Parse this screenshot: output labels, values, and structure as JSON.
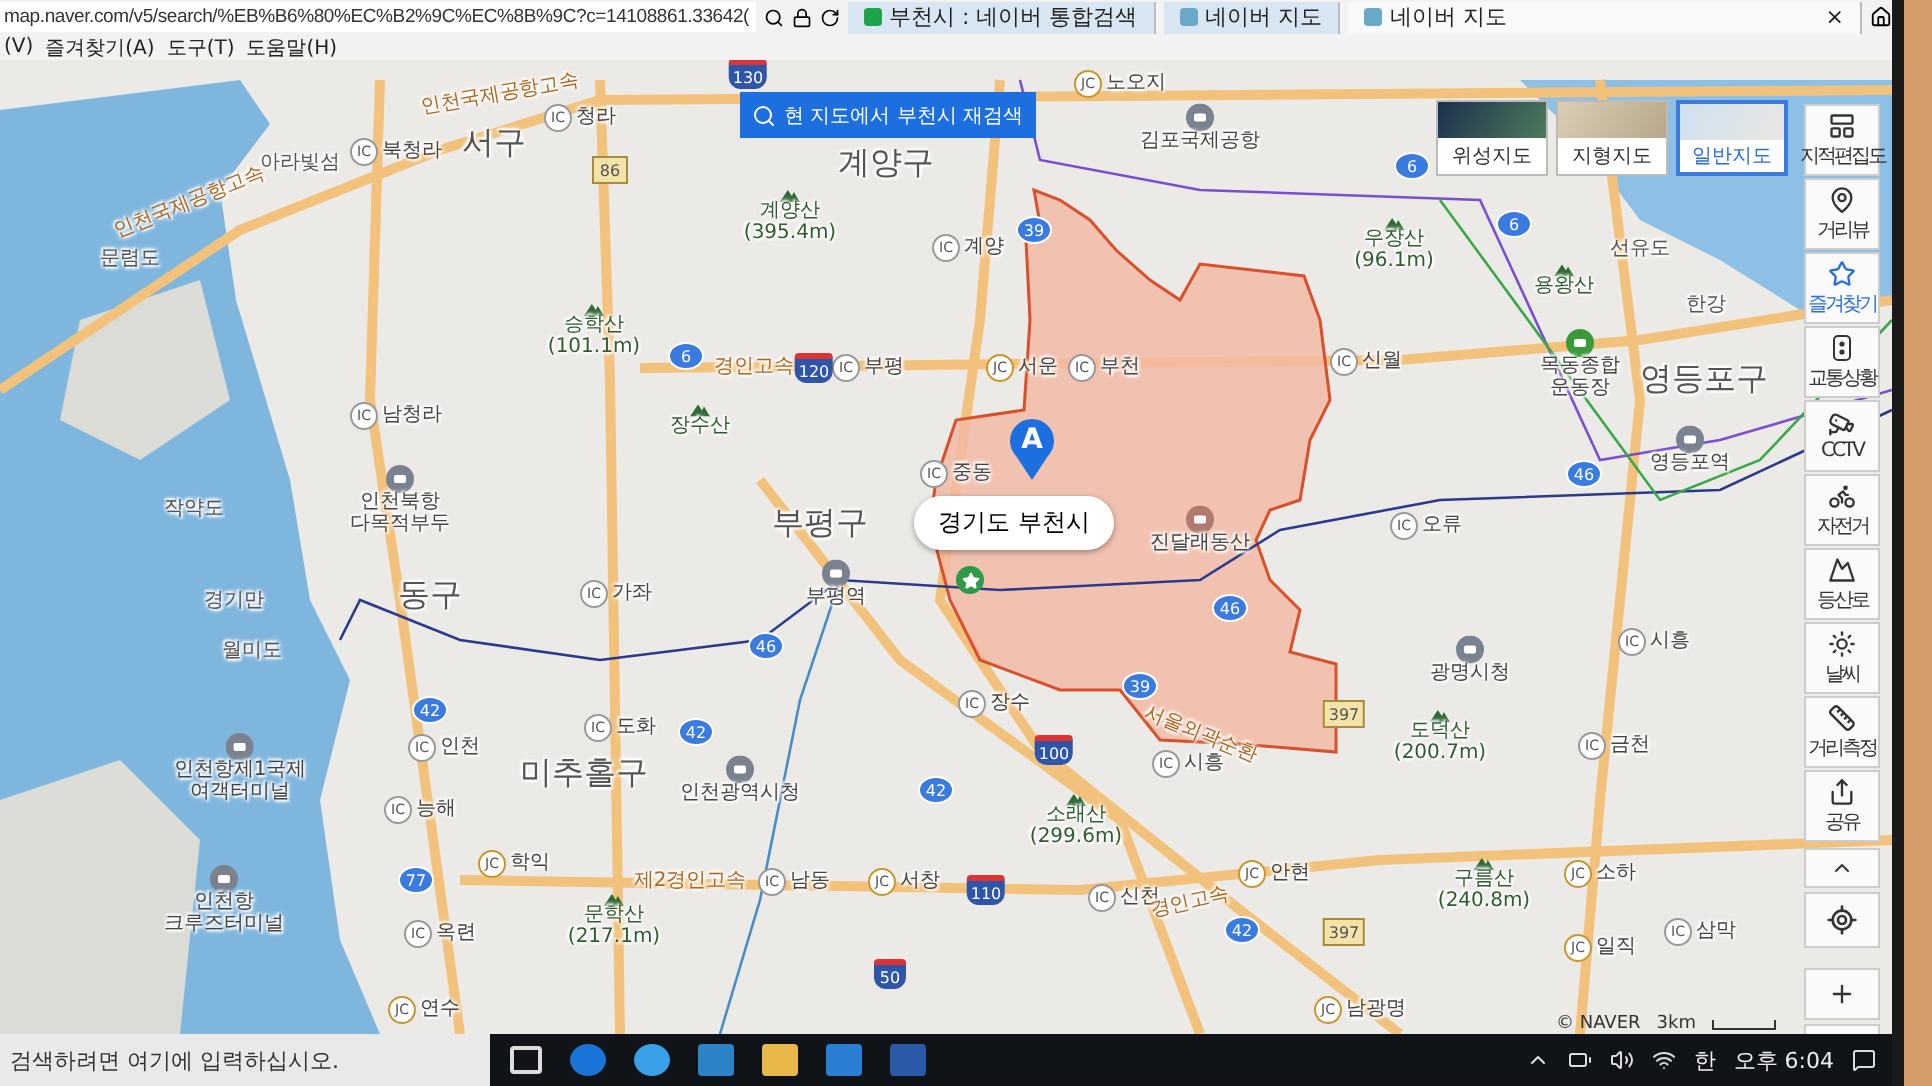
{
  "browser": {
    "address": "map.naver.com/v5/search/%EB%B6%80%EC%B2%9C%EC%8B%9C?c=14108861.33642(",
    "tabs": [
      {
        "label": "부천시 : 네이버 통합검색",
        "selected": false
      },
      {
        "label": "네이버 지도",
        "selected": false
      },
      {
        "label": "네이버 지도",
        "selected": true,
        "close": "×"
      }
    ],
    "menu": [
      "(V)",
      "즐겨찾기(A)",
      "도구(T)",
      "도움말(H)"
    ]
  },
  "map": {
    "research_button": "현 지도에서 부천시 재검색",
    "map_types": [
      {
        "label": "위성지도",
        "selected": false
      },
      {
        "label": "지형지도",
        "selected": false
      },
      {
        "label": "일반지도",
        "selected": true
      }
    ],
    "tools": [
      {
        "label": "지적편집도",
        "selected": false
      },
      {
        "label": "거리뷰",
        "selected": false
      },
      {
        "label": "즐겨찾기",
        "selected": true
      },
      {
        "label": "교통상황",
        "selected": false
      },
      {
        "label": "CCTV",
        "selected": false
      },
      {
        "label": "자전거",
        "selected": false
      },
      {
        "label": "등산로",
        "selected": false
      },
      {
        "label": "날씨",
        "selected": false
      },
      {
        "label": "거리측정",
        "selected": false
      },
      {
        "label": "공유",
        "selected": false
      }
    ],
    "marker": {
      "letter": "A",
      "label": "경기도 부천시"
    },
    "labels": [
      {
        "kind": "district",
        "text": "서구"
      },
      {
        "kind": "district",
        "text": "계양구"
      },
      {
        "kind": "district",
        "text": "부평구"
      },
      {
        "kind": "district",
        "text": "동구"
      },
      {
        "kind": "district",
        "text": "미추홀구"
      },
      {
        "kind": "district",
        "text": "영등포구"
      },
      {
        "kind": "place",
        "text": "아라빛섬"
      },
      {
        "kind": "place",
        "text": "문렴도"
      },
      {
        "kind": "place",
        "text": "작약도"
      },
      {
        "kind": "place",
        "text": "경기만"
      },
      {
        "kind": "place",
        "text": "월미도"
      },
      {
        "kind": "terminal",
        "text": "인천북항",
        "sub": "다목적부두"
      },
      {
        "kind": "terminal",
        "text": "인천항제1국제",
        "sub": "여객터미널"
      },
      {
        "kind": "terminal",
        "text": "인천항",
        "sub": "크루즈터미널"
      },
      {
        "kind": "airport",
        "text": "김포국제공항"
      },
      {
        "kind": "station",
        "text": "부평역"
      },
      {
        "kind": "station",
        "text": "영등포역"
      },
      {
        "kind": "hall",
        "text": "인천광역시청"
      },
      {
        "kind": "hall",
        "text": "광명시청"
      },
      {
        "kind": "stadium",
        "text": "목동종합",
        "sub": "운동장"
      },
      {
        "kind": "place",
        "text": "선유도"
      },
      {
        "kind": "place",
        "text": "한강"
      },
      {
        "kind": "park",
        "text": "진달래동산"
      },
      {
        "kind": "mountain",
        "text": "계양산",
        "sub": "(395.4m)"
      },
      {
        "kind": "mountain",
        "text": "승학산",
        "sub": "(101.1m)"
      },
      {
        "kind": "mountain",
        "text": "장수산"
      },
      {
        "kind": "mountain",
        "text": "우장산",
        "sub": "(96.1m)"
      },
      {
        "kind": "mountain",
        "text": "용왕산"
      },
      {
        "kind": "mountain",
        "text": "소래산",
        "sub": "(299.6m)"
      },
      {
        "kind": "mountain",
        "text": "문학산",
        "sub": "(217.1m)"
      },
      {
        "kind": "mountain",
        "text": "도덕산",
        "sub": "(200.7m)"
      },
      {
        "kind": "mountain",
        "text": "구름산",
        "sub": "(240.8m)"
      },
      {
        "kind": "interchange",
        "badge": "IC",
        "text": "청라"
      },
      {
        "kind": "interchange",
        "badge": "IC",
        "text": "북청라"
      },
      {
        "kind": "interchange",
        "badge": "IC",
        "text": "남청라"
      },
      {
        "kind": "interchange",
        "badge": "IC",
        "text": "부평"
      },
      {
        "kind": "interchange",
        "badge": "IC",
        "text": "계양"
      },
      {
        "kind": "interchange",
        "badge": "JC",
        "text": "서운"
      },
      {
        "kind": "interchange",
        "badge": "IC",
        "text": "부천"
      },
      {
        "kind": "interchange",
        "badge": "IC",
        "text": "신월"
      },
      {
        "kind": "interchange",
        "badge": "IC",
        "text": "중동"
      },
      {
        "kind": "interchange",
        "badge": "IC",
        "text": "가좌"
      },
      {
        "kind": "interchange",
        "badge": "IC",
        "text": "오류"
      },
      {
        "kind": "interchange",
        "badge": "IC",
        "text": "도화"
      },
      {
        "kind": "interchange",
        "badge": "IC",
        "text": "인천"
      },
      {
        "kind": "interchange",
        "badge": "IC",
        "text": "장수"
      },
      {
        "kind": "interchange",
        "badge": "IC",
        "text": "시흥"
      },
      {
        "kind": "interchange",
        "badge": "IC",
        "text": "능해"
      },
      {
        "kind": "interchange",
        "badge": "JC",
        "text": "학익"
      },
      {
        "kind": "interchange",
        "badge": "IC",
        "text": "남동"
      },
      {
        "kind": "interchange",
        "badge": "JC",
        "text": "서창"
      },
      {
        "kind": "interchange",
        "badge": "IC",
        "text": "신천"
      },
      {
        "kind": "interchange",
        "badge": "JC",
        "text": "안현"
      },
      {
        "kind": "interchange",
        "badge": "IC",
        "text": "시흥"
      },
      {
        "kind": "interchange",
        "badge": "IC",
        "text": "금천"
      },
      {
        "kind": "interchange",
        "badge": "JC",
        "text": "소하"
      },
      {
        "kind": "interchange",
        "badge": "IC",
        "text": "옥련"
      },
      {
        "kind": "interchange",
        "badge": "JC",
        "text": "일직"
      },
      {
        "kind": "interchange",
        "badge": "IC",
        "text": "삼막"
      },
      {
        "kind": "interchange",
        "badge": "JC",
        "text": "연수"
      },
      {
        "kind": "interchange",
        "badge": "JC",
        "text": "남광명"
      },
      {
        "kind": "interchange",
        "badge": "JC",
        "text": "노오지"
      },
      {
        "kind": "road",
        "text": "인천국제공항고속"
      },
      {
        "kind": "road",
        "text": "인천국제공항고속"
      },
      {
        "kind": "road",
        "text": "경인고속"
      },
      {
        "kind": "road",
        "text": "제2경인고속"
      },
      {
        "kind": "road",
        "text": "서울외곽순환"
      },
      {
        "kind": "road",
        "text": "경인고속"
      },
      {
        "kind": "expressway",
        "text": "130"
      },
      {
        "kind": "national",
        "text": "86"
      },
      {
        "kind": "route",
        "text": "6"
      },
      {
        "kind": "expressway",
        "text": "120"
      },
      {
        "kind": "route",
        "text": "39"
      },
      {
        "kind": "route",
        "text": "6"
      },
      {
        "kind": "route",
        "text": "6"
      },
      {
        "kind": "route",
        "text": "46"
      },
      {
        "kind": "route",
        "text": "42"
      },
      {
        "kind": "route",
        "text": "42"
      },
      {
        "kind": "route",
        "text": "42"
      },
      {
        "kind": "route",
        "text": "77"
      },
      {
        "kind": "expressway",
        "text": "100"
      },
      {
        "kind": "route",
        "text": "39"
      },
      {
        "kind": "route",
        "text": "46"
      },
      {
        "kind": "national",
        "text": "397"
      },
      {
        "kind": "expressway",
        "text": "110"
      },
      {
        "kind": "route",
        "text": "42"
      },
      {
        "kind": "national",
        "text": "397"
      },
      {
        "kind": "expressway",
        "text": "50"
      },
      {
        "kind": "route",
        "text": "46"
      }
    ],
    "copyright": "© NAVER",
    "scale": "3km"
  },
  "taskbar": {
    "search_placeholder": "검색하려면 여기에 입력하십시오.",
    "ime": "한",
    "time": "오후 6:04"
  }
}
